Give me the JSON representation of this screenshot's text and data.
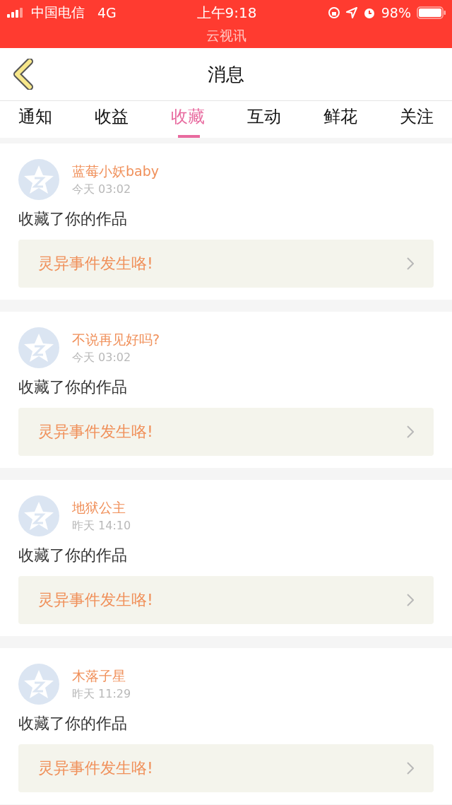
{
  "status_bar": {
    "carrier": "中国电信",
    "network": "4G",
    "time": "上午9:18",
    "battery": "98%",
    "app_title": "云视讯"
  },
  "header": {
    "title": "消息"
  },
  "tabs": [
    {
      "label": "通知",
      "selected": false
    },
    {
      "label": "收益",
      "selected": false
    },
    {
      "label": "收藏",
      "selected": true
    },
    {
      "label": "互动",
      "selected": false
    },
    {
      "label": "鲜花",
      "selected": false
    },
    {
      "label": "关注",
      "selected": false
    }
  ],
  "messages": [
    {
      "name": "蓝莓小妖baby",
      "time": "今天 03:02",
      "action": "收藏了你的作品",
      "work": "灵异事件发生咯!"
    },
    {
      "name": "不说再见好吗?",
      "time": "今天 03:02",
      "action": "收藏了你的作品",
      "work": "灵异事件发生咯!"
    },
    {
      "name": "地狱公主",
      "time": "昨天 14:10",
      "action": "收藏了你的作品",
      "work": "灵异事件发生咯!"
    },
    {
      "name": "木落子星",
      "time": "昨天 11:29",
      "action": "收藏了你的作品",
      "work": "灵异事件发生咯!"
    }
  ]
}
